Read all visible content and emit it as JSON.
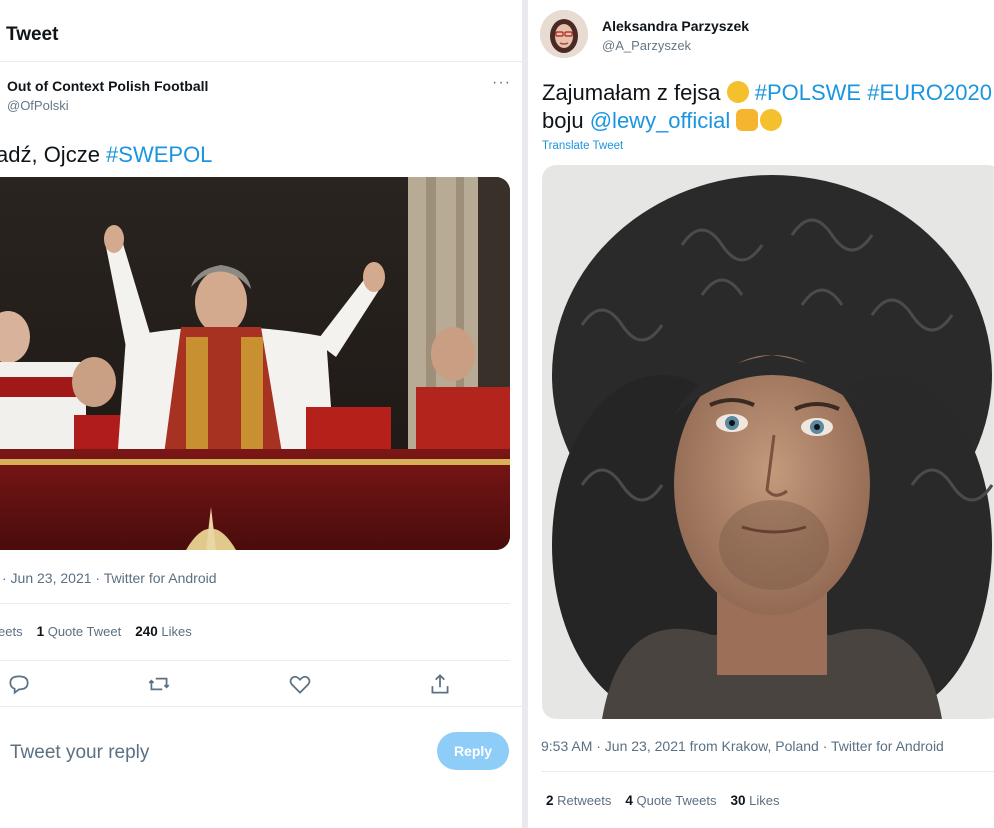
{
  "left_tweet": {
    "header_title": "Tweet",
    "author_name": "Out of Context Polish Football",
    "author_handle": "@OfPolski",
    "more": "···",
    "text_plain": "adź, Ojcze ",
    "text_tag": "#SWEPOL",
    "meta": "· Jun 23, 2021 · Twitter for Android",
    "retweets_label": "eets",
    "quote_count": "1",
    "quote_label": "Quote Tweet",
    "likes_count": "240",
    "likes_label": "Likes",
    "reply_placeholder": "Tweet your reply",
    "reply_button": "Reply"
  },
  "right_tweet": {
    "author_name": "Aleksandra Parzyszek",
    "author_handle": "@A_Parzyszek",
    "line1_plain": "Zajumałam z fejsa ",
    "line1_tags": " #POLSWE #EURO2020",
    "line2_plain": "boju ",
    "line2_mention": "@lewy_official",
    "translate": "Translate Tweet",
    "meta": "9:53 AM · Jun 23, 2021 from Krakow, Poland · Twitter for Android",
    "retweets_count": "2",
    "retweets_label": "Retweets",
    "quotes_count": "4",
    "quotes_label": "Quote Tweets",
    "likes_count": "30",
    "likes_label": "Likes"
  },
  "colors": {
    "link": "#1b95e0",
    "muted": "#5b7083",
    "reply_button": "#8ecdf7"
  }
}
